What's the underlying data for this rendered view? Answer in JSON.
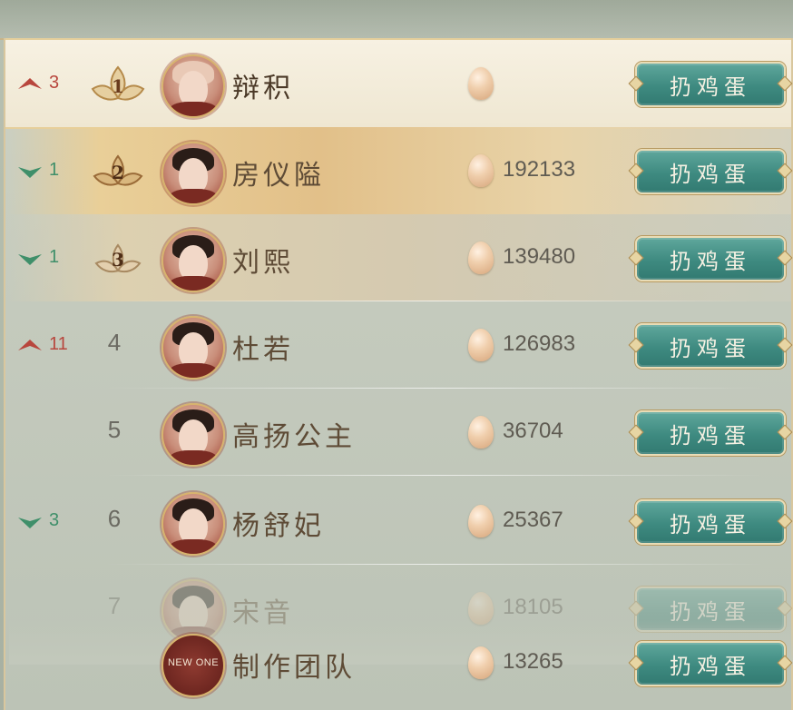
{
  "button_label": "扔鸡蛋",
  "colors": {
    "up": "#b8463d",
    "down": "#3f8f6a",
    "button": "#3e8a80",
    "gold": "#c9a66b"
  },
  "rows": [
    {
      "rank": "1",
      "change_dir": "up",
      "change": "3",
      "name": "辩积",
      "score": "",
      "avatar": "bald"
    },
    {
      "rank": "2",
      "change_dir": "down",
      "change": "1",
      "name": "房仪隘",
      "score": "192133",
      "avatar": "male"
    },
    {
      "rank": "3",
      "change_dir": "down",
      "change": "1",
      "name": "刘熙",
      "score": "139480",
      "avatar": "female"
    },
    {
      "rank": "4",
      "change_dir": "up",
      "change": "11",
      "name": "杜若",
      "score": "126983",
      "avatar": "female"
    },
    {
      "rank": "5",
      "change_dir": "",
      "change": "",
      "name": "高扬公主",
      "score": "36704",
      "avatar": "female"
    },
    {
      "rank": "6",
      "change_dir": "down",
      "change": "3",
      "name": "杨舒妃",
      "score": "25367",
      "avatar": "female"
    },
    {
      "rank": "7",
      "change_dir": "",
      "change": "",
      "name": "宋音",
      "score": "18105",
      "avatar": "female"
    }
  ],
  "self_row": {
    "name": "制作团队",
    "score": "13265",
    "logo_text": "NEW ONE"
  }
}
